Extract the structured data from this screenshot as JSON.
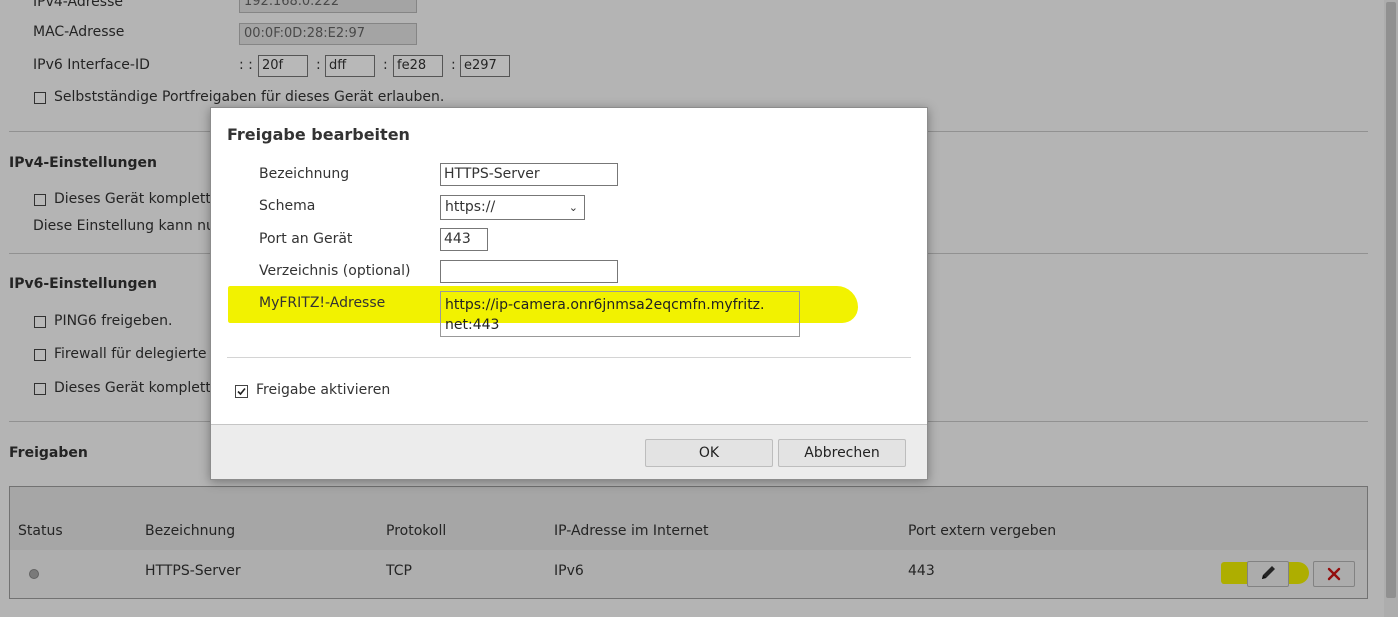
{
  "background": {
    "ipv4": {
      "label": "IPv4-Adresse",
      "value": "192.168.0.222"
    },
    "mac": {
      "label": "MAC-Adresse",
      "value": "00:0F:0D:28:E2:97"
    },
    "ipv6_iface": {
      "label": "IPv6 Interface-ID",
      "prefix": ": :",
      "sep": ":",
      "parts": [
        "20f",
        "dff",
        "fe28",
        "e297"
      ]
    },
    "self_port_label": "Selbstständige Portfreigaben für dieses Gerät erlauben.",
    "ipv4_settings": {
      "title": "IPv4-Einstellungen",
      "exposed_host": "Dieses Gerät komplett f",
      "note": "Diese Einstellung kann nur"
    },
    "ipv6_settings": {
      "title": "IPv6-Einstellungen",
      "ping6": "PING6 freigeben.",
      "firewall": "Firewall für delegierte II",
      "exposed_host": "Dieses Gerät komplett f"
    },
    "freigaben": {
      "title": "Freigaben",
      "headers": [
        "Status",
        "Bezeichnung",
        "Protokoll",
        "IP-Adresse im Internet",
        "Port extern vergeben"
      ],
      "row": {
        "name": "HTTPS-Server",
        "protocol": "TCP",
        "ip": "IPv6",
        "port": "443"
      }
    }
  },
  "dialog": {
    "title": "Freigabe bearbeiten",
    "fields": {
      "bezeichnung": {
        "label": "Bezeichnung",
        "value": "HTTPS-Server"
      },
      "schema": {
        "label": "Schema",
        "value": "https://"
      },
      "port": {
        "label": "Port an Gerät",
        "value": "443"
      },
      "verzeichnis": {
        "label": "Verzeichnis (optional)",
        "value": ""
      },
      "myfritz": {
        "label": "MyFRITZ!-Adresse",
        "value_line1": "https://ip-camera.onr6jnmsa2eqcmfn.myfritz.",
        "value_line2": "net:443"
      }
    },
    "activate_label": "Freigabe aktivieren",
    "activate_checked": true,
    "ok_label": "OK",
    "cancel_label": "Abbrechen"
  },
  "colors": {
    "highlight": "#f2f200",
    "delete_red": "#cc1111"
  }
}
